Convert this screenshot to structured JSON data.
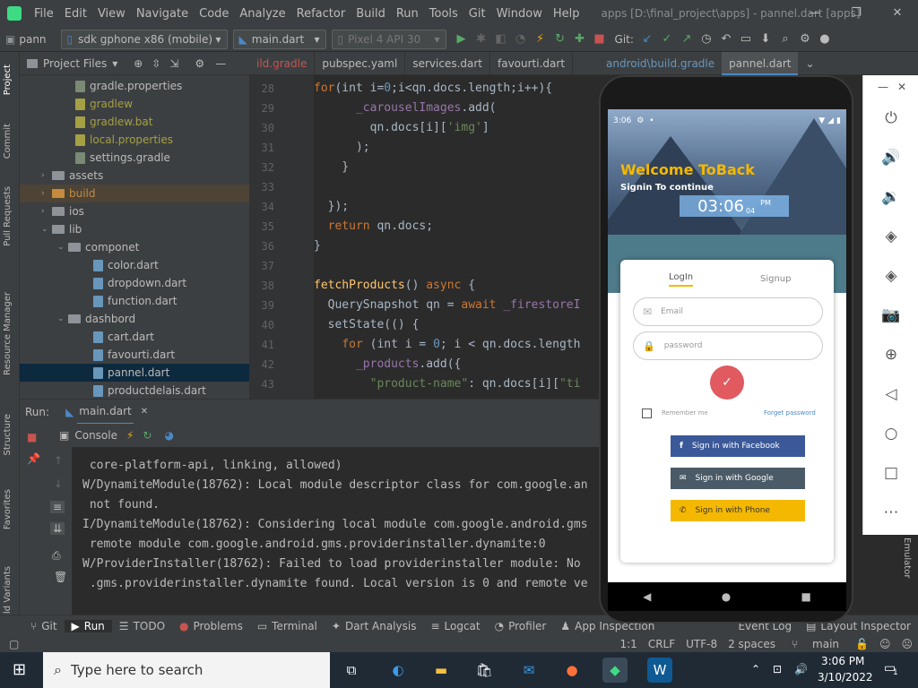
{
  "menubar": {
    "items": [
      "File",
      "Edit",
      "View",
      "Navigate",
      "Code",
      "Analyze",
      "Refactor",
      "Build",
      "Run",
      "Tools",
      "Git",
      "Window",
      "Help"
    ],
    "title": "apps [D:\\final_project\\apps] - pannel.dart [apps]"
  },
  "toolbar": {
    "project": "pann",
    "device": "sdk gphone x86 (mobile)",
    "config": "main.dart",
    "avd": "Pixel 4 API 30",
    "git": "Git:"
  },
  "project_panel": {
    "title": "Project Files",
    "items": [
      {
        "label": "gradle.properties",
        "type": "file-g"
      },
      {
        "label": "gradlew",
        "type": "file-y"
      },
      {
        "label": "gradlew.bat",
        "type": "file-y"
      },
      {
        "label": "local.properties",
        "type": "file-y"
      },
      {
        "label": "settings.gradle",
        "type": "file-g"
      },
      {
        "label": "assets",
        "type": "folder"
      },
      {
        "label": "build",
        "type": "folder-orange"
      },
      {
        "label": "ios",
        "type": "folder"
      },
      {
        "label": "lib",
        "type": "folder"
      },
      {
        "label": "componet",
        "type": "folder"
      },
      {
        "label": "color.dart",
        "type": "file"
      },
      {
        "label": "dropdown.dart",
        "type": "file"
      },
      {
        "label": "function.dart",
        "type": "file"
      },
      {
        "label": "dashbord",
        "type": "folder"
      },
      {
        "label": "cart.dart",
        "type": "file"
      },
      {
        "label": "favourti.dart",
        "type": "file"
      },
      {
        "label": "pannel.dart",
        "type": "file"
      },
      {
        "label": "productdelais.dart",
        "type": "file"
      }
    ]
  },
  "tabs": [
    "ild.gradle",
    "pubspec.yaml",
    "services.dart",
    "favourti.dart"
  ],
  "tabs2": [
    "android\\build.gradle",
    "pannel.dart"
  ],
  "line_numbers": [
    "28",
    "29",
    "30",
    "31",
    "32",
    "33",
    "34",
    "35",
    "36",
    "37",
    "38",
    "39",
    "40",
    "41",
    "42",
    "43"
  ],
  "code_lines": [
    "    for(int i=0;i<qn.docs.length;i++){",
    "      _carouselImages.add(",
    "        qn.docs[i]['img']",
    "      );",
    "    }",
    "",
    "  });",
    "  return qn.docs;",
    "}",
    "",
    "fetchProducts() async {",
    "  QuerySnapshot qn = await _firestoreI",
    "  setState(() {",
    "    for (int i = 0; i < qn.docs.length",
    "      _products.add({",
    "        \"product-name\": qn.docs[i][\"ti"
  ],
  "run": {
    "label": "Run:",
    "config": "main.dart",
    "console": "Console"
  },
  "console_lines": [
    "W/DynamiteModule(18762): Local module descriptor class for com.google.an",
    " not found.",
    "I/DynamiteModule(18762): Considering local module com.google.android.gms",
    " remote module com.google.android.gms.providerinstaller.dynamite:0",
    "W/ProviderInstaller(18762): Failed to load providerinstaller module: No",
    " .gms.providerinstaller.dynamite found. Local version is 0 and remote ve"
  ],
  "console_top": " core-platform-api, linking, allowed)",
  "bottom_tabs": [
    "Git",
    "Run",
    "TODO",
    "Problems",
    "Terminal",
    "Dart Analysis",
    "Logcat",
    "Profiler",
    "App Inspection"
  ],
  "bottom_right": [
    "Event Log",
    "Layout Inspector"
  ],
  "status": {
    "pos": "1:1",
    "eol": "CRLF",
    "enc": "UTF-8",
    "indent": "2 spaces",
    "branch": "main"
  },
  "left_vtabs": [
    "Project",
    "Commit",
    "Pull Requests",
    "Resource Manager",
    "Structure",
    "Favorites",
    "Build Variants"
  ],
  "phone": {
    "status_time": "3:06",
    "welcome": "Welcome ToBack",
    "signin": "Signin To continue",
    "clock_h": "03",
    "clock_m": "06",
    "clock_s": "04",
    "clock_ampm": "PM",
    "tab_login": "LogIn",
    "tab_signup": "Signup",
    "email_ph": "Email",
    "password_ph": "password",
    "remember": "Remember me",
    "forget": "Forget password",
    "facebook": "Sign in with Facebook",
    "google": "Sign in with Google",
    "phone": "Sign in with Phone"
  },
  "taskbar": {
    "search": "Type here to search",
    "time": "3:06 PM",
    "date": "3/10/2022",
    "notif": "1"
  },
  "right_vtab": "Emulator",
  "colors": {
    "accent": "#4a88c7",
    "facebook": "#3b5998",
    "google": "#4a5a66",
    "phone": "#f5b800",
    "login_btn": "#e05a60"
  }
}
